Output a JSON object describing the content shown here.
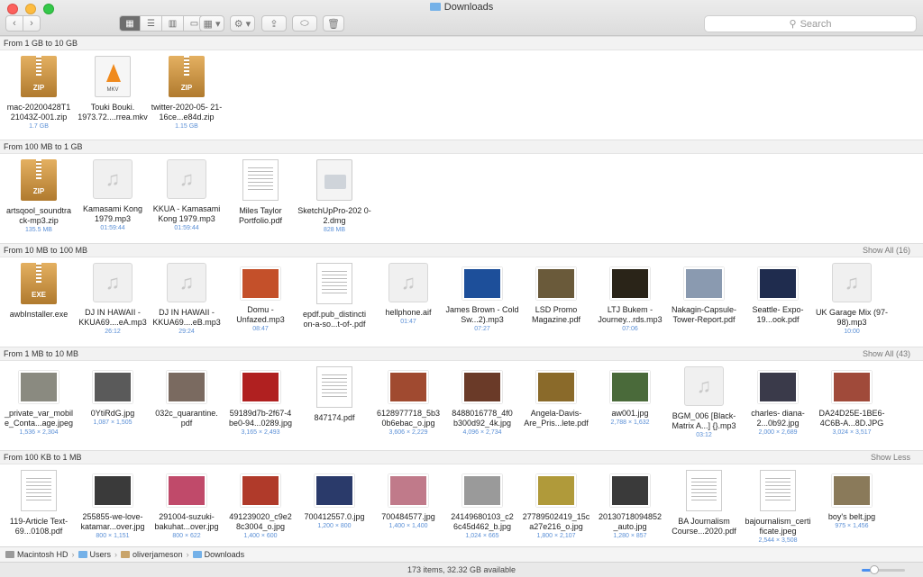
{
  "window": {
    "title": "Downloads"
  },
  "toolbar": {
    "back_label": "‹",
    "forward_label": "›",
    "view_modes": [
      "▦",
      "☰",
      "▥",
      "▭"
    ],
    "arrange_label": "▦ ▾",
    "action_label": "⚙ ▾",
    "share_label": "⇪",
    "tag_label": "⬭",
    "delete_label": "🗑"
  },
  "search": {
    "placeholder": "Search",
    "icon": "search-icon"
  },
  "groups": [
    {
      "title": "From 1 GB to 10 GB",
      "action": "",
      "items": [
        {
          "name": "mac-20200428T1 21043Z-001.zip",
          "meta": "1.7 GB",
          "icon": "zip",
          "tag": "ZIP"
        },
        {
          "name": "Touki Bouki. 1973.72....rrea.mkv",
          "meta": "",
          "icon": "mkv",
          "tag": "MKV"
        },
        {
          "name": "twitter-2020-05- 21-16ce...e84d.zip",
          "meta": "1.15 GB",
          "icon": "zip",
          "tag": "ZIP"
        }
      ]
    },
    {
      "title": "From 100 MB to 1 GB",
      "action": "",
      "items": [
        {
          "name": "artsqool_soundtra ck-mp3.zip",
          "meta": "135.5 MB",
          "icon": "zip",
          "tag": "ZIP"
        },
        {
          "name": "Kamasami Kong 1979.mp3",
          "meta": "01:59:44",
          "icon": "audio"
        },
        {
          "name": "KKUA - Kamasami Kong 1979.mp3",
          "meta": "01:59:44",
          "icon": "audio"
        },
        {
          "name": "Miles Taylor Portfolio.pdf",
          "meta": "",
          "icon": "pdf"
        },
        {
          "name": "SketchUpPro-202 0-2.dmg",
          "meta": "828 MB",
          "icon": "dmg"
        }
      ]
    },
    {
      "title": "From 10 MB to 100 MB",
      "action": "Show All (16)",
      "items": [
        {
          "name": "awbInstaller.exe",
          "meta": "",
          "icon": "zip",
          "tag": "EXE"
        },
        {
          "name": "DJ IN HAWAII - KKUA69....eA.mp3",
          "meta": "26:12",
          "icon": "audio"
        },
        {
          "name": "DJ IN HAWAII - KKUA69....eB.mp3",
          "meta": "29:24",
          "icon": "audio"
        },
        {
          "name": "Domu - Unfazed.mp3",
          "meta": "08:47",
          "icon": "photo",
          "color": "#c4502a"
        },
        {
          "name": "epdf.pub_distincti on-a-so...t-of-.pdf",
          "meta": "",
          "icon": "pdf"
        },
        {
          "name": "hellphone.aif",
          "meta": "01:47",
          "icon": "audio"
        },
        {
          "name": "James Brown - Cold Sw...2).mp3",
          "meta": "07:27",
          "icon": "photo",
          "color": "#1d4f9a"
        },
        {
          "name": "LSD Promo Magazine.pdf",
          "meta": "",
          "icon": "photo",
          "color": "#6a5a3a"
        },
        {
          "name": "LTJ Bukem - Journey...rds.mp3",
          "meta": "07:06",
          "icon": "photo",
          "color": "#2a2418"
        },
        {
          "name": "Nakagin-Capsule- Tower-Report.pdf",
          "meta": "",
          "icon": "photo",
          "color": "#8a9ab0"
        },
        {
          "name": "Seattle- Expo-19...ook.pdf",
          "meta": "",
          "icon": "photo",
          "color": "#1f2c4e"
        },
        {
          "name": "UK Garage Mix (97-98).mp3",
          "meta": "10:00",
          "icon": "audio"
        }
      ]
    },
    {
      "title": "From 1 MB to 10 MB",
      "action": "Show All (43)",
      "items": [
        {
          "name": "_private_var_mobil e_Conta...age.jpeg",
          "meta": "1,536 × 2,304",
          "icon": "photo",
          "color": "#8a8a80"
        },
        {
          "name": "0YtiRdG.jpg",
          "meta": "1,087 × 1,505",
          "icon": "photo",
          "color": "#5a5a5a"
        },
        {
          "name": "032c_quarantine. pdf",
          "meta": "",
          "icon": "photo",
          "color": "#7a6a60"
        },
        {
          "name": "59189d7b-2f67-4 be0-94...0289.jpg",
          "meta": "3,165 × 2,493",
          "icon": "photo",
          "color": "#b02020"
        },
        {
          "name": "847174.pdf",
          "meta": "",
          "icon": "pdf"
        },
        {
          "name": "6128977718_5b3 0b6ebac_o.jpg",
          "meta": "3,606 × 2,229",
          "icon": "photo",
          "color": "#a04a30"
        },
        {
          "name": "8488016778_4f0 b300d92_4k.jpg",
          "meta": "4,096 × 2,734",
          "icon": "photo",
          "color": "#6a3a28"
        },
        {
          "name": "Angela-Davis- Are_Pris...lete.pdf",
          "meta": "",
          "icon": "photo",
          "color": "#8a6a2a"
        },
        {
          "name": "aw001.jpg",
          "meta": "2,788 × 1,632",
          "icon": "photo",
          "color": "#4a6a3a"
        },
        {
          "name": "BGM_006 [Black- Matrix A...] {}.mp3",
          "meta": "03:12",
          "icon": "audio"
        },
        {
          "name": "charles- diana-2...0b92.jpg",
          "meta": "2,000 × 2,689",
          "icon": "photo",
          "color": "#3a3a4a"
        },
        {
          "name": "DA24D25E-1BE6- 4C6B-A...8D.JPG",
          "meta": "3,024 × 3,517",
          "icon": "photo",
          "color": "#a04a3a"
        }
      ]
    },
    {
      "title": "From 100 KB to 1 MB",
      "action": "Show Less",
      "items": [
        {
          "name": "119-Article Text-69...0108.pdf",
          "meta": "",
          "icon": "pdf"
        },
        {
          "name": "255855-we-love- katamar...over.jpg",
          "meta": "800 × 1,151",
          "icon": "photo",
          "color": "#3a3a3a"
        },
        {
          "name": "291004-suzuki- bakuhat...over.jpg",
          "meta": "800 × 622",
          "icon": "photo",
          "color": "#c04a6a"
        },
        {
          "name": "491239020_c9e2 8c3004_o.jpg",
          "meta": "1,400 × 600",
          "icon": "photo",
          "color": "#b03a2a"
        },
        {
          "name": "700412557.0.jpg",
          "meta": "1,200 × 800",
          "icon": "photo",
          "color": "#2a3a6a"
        },
        {
          "name": "700484577.jpg",
          "meta": "1,400 × 1,400",
          "icon": "photo",
          "color": "#c07a8a"
        },
        {
          "name": "24149680103_c2 6c45d462_b.jpg",
          "meta": "1,024 × 665",
          "icon": "photo",
          "color": "#9a9a9a"
        },
        {
          "name": "27789502419_15c a27e216_o.jpg",
          "meta": "1,800 × 2,107",
          "icon": "photo",
          "color": "#b09a3a"
        },
        {
          "name": "20130718094852 _auto.jpg",
          "meta": "1,280 × 857",
          "icon": "photo",
          "color": "#3a3a3a"
        },
        {
          "name": "BA Journalism Course...2020.pdf",
          "meta": "",
          "icon": "pdf"
        },
        {
          "name": "bajournalism_certi ficate.jpeg",
          "meta": "2,544 × 3,508",
          "icon": "pdf"
        },
        {
          "name": "boy's belt.jpg",
          "meta": "975 × 1,456",
          "icon": "photo",
          "color": "#8a7a5a"
        }
      ]
    }
  ],
  "path": [
    {
      "label": "Macintosh HD",
      "color": "#9a9a9a"
    },
    {
      "label": "Users",
      "color": "#74b1e8"
    },
    {
      "label": "oliverjameson",
      "color": "#c9a46a"
    },
    {
      "label": "Downloads",
      "color": "#74b1e8"
    }
  ],
  "status": {
    "text": "173 items, 32.32 GB available",
    "icon_size_fraction": 0.3
  }
}
